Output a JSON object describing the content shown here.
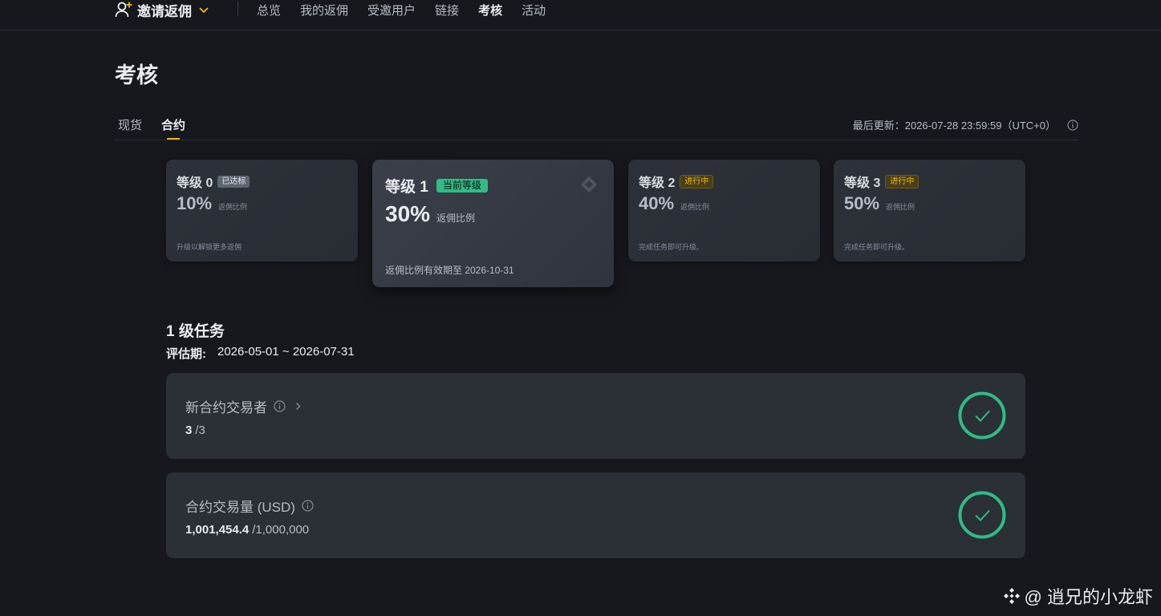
{
  "nav": {
    "brand_label": "邀请返佣",
    "items": [
      "总览",
      "我的返佣",
      "受邀用户",
      "链接",
      "考核",
      "活动"
    ],
    "active_index": 4
  },
  "page": {
    "title": "考核",
    "tabs": [
      "现货",
      "合约"
    ],
    "active_tab": 1,
    "last_update": "最后更新：2026-07-28 23:59:59（UTC+0）"
  },
  "tiers": [
    {
      "name": "等级 0",
      "badge": "已达标",
      "rate": "10%",
      "rate_label": "返佣比例",
      "note": "升级以解锁更多返佣"
    },
    {
      "name": "等级 1",
      "badge": "当前等级",
      "rate": "30%",
      "rate_label": "返佣比例",
      "note": "返佣比例有效期至 2026-10-31"
    },
    {
      "name": "等级 2",
      "badge": "进行中",
      "rate": "40%",
      "rate_label": "返佣比例",
      "note": "完成任务即可升级。"
    },
    {
      "name": "等级 3",
      "badge": "进行中",
      "rate": "50%",
      "rate_label": "返佣比例",
      "note": "完成任务即可升级。"
    }
  ],
  "tasks": {
    "title": "1 级任务",
    "period_label": "评估期:",
    "period_value": "2026-05-01 ~ 2026-07-31",
    "items": [
      {
        "name": "新合约交易者",
        "current": "3",
        "target": "/3",
        "completed": true
      },
      {
        "name": "合约交易量 (USD)",
        "current": "1,001,454.4",
        "target": "/1,000,000",
        "completed": true
      }
    ]
  },
  "watermark": "@ 逍兄的小龙虾",
  "colors": {
    "background": "#16181d",
    "card": "#2b2f36",
    "accent_yellow": "#f0b90b",
    "success_green": "#2ebd85"
  },
  "icons": [
    "user-add-icon",
    "chevron-down-icon",
    "info-icon",
    "diamond-icon",
    "chevron-right-icon",
    "check-circle-icon",
    "binance-logo-icon"
  ]
}
